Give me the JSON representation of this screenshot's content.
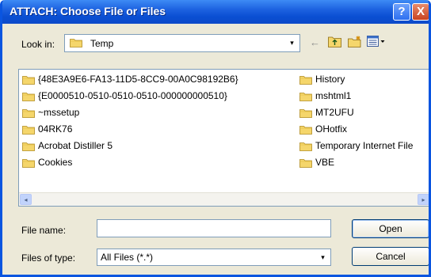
{
  "window": {
    "title": "ATTACH: Choose File or Files",
    "help_glyph": "?",
    "close_glyph": "X"
  },
  "lookin": {
    "label": "Look in:",
    "value": "Temp",
    "dropdown_glyph": "▾"
  },
  "toolbar": {
    "back_glyph": "←"
  },
  "files": {
    "col1": [
      "{48E3A9E6-FA13-11D5-8CC9-00A0C98192B6}",
      "{E0000510-0510-0510-0510-000000000510}",
      "~mssetup",
      "04RK76",
      "Acrobat Distiller 5",
      "Cookies"
    ],
    "col2": [
      "History",
      "mshtml1",
      "MT2UFU",
      "OHotfix",
      "Temporary Internet File",
      "VBE"
    ]
  },
  "scroll": {
    "left_glyph": "◂",
    "right_glyph": "▸"
  },
  "form": {
    "filename_label": "File name:",
    "filename_value": "",
    "filetype_label": "Files of type:",
    "filetype_value": "All Files (*.*)",
    "filetype_dropdown_glyph": "▾"
  },
  "buttons": {
    "open": "Open",
    "cancel": "Cancel"
  },
  "colors": {
    "titlebar": "#0a4fd3",
    "folder": "#f5d66b",
    "dialog_bg": "#ece9d8"
  }
}
